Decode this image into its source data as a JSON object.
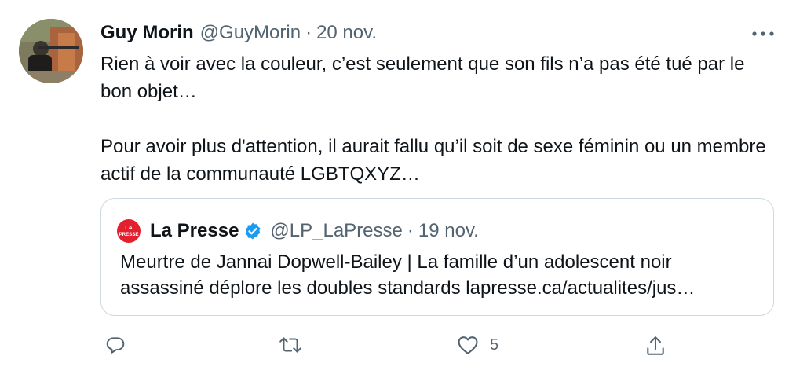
{
  "tweet": {
    "author_name": "Guy Morin",
    "author_handle": "@GuyMorin",
    "separator": "·",
    "date": "20 nov.",
    "more_icon": "more-dots-icon",
    "text_lines": [
      "Rien à voir avec la couleur, c’est seulement que son fils n’a pas été tué par le bon objet…",
      "Pour avoir plus d'attention, il aurait fallu qu’il soit de sexe féminin ou un membre actif de la communauté LGBTQXYZ…"
    ]
  },
  "quote": {
    "logo_text_top": "LA",
    "logo_text_bottom": "PRESSE",
    "author_name": "La Presse",
    "verified_icon": "verified-badge-icon",
    "author_handle": "@LP_LaPresse",
    "separator": "·",
    "date": "19 nov.",
    "text_line1": "Meurtre de Jannai Dopwell-Bailey | La famille d’un adolescent noir",
    "text_line2": "assassiné déplore les doubles standards lapresse.ca/actualites/jus…"
  },
  "actions": {
    "reply_icon": "reply-icon",
    "retweet_icon": "retweet-icon",
    "like_icon": "like-heart-icon",
    "like_count": "5",
    "share_icon": "share-icon"
  },
  "colors": {
    "text": "#0f1419",
    "secondary": "#536471",
    "border": "#cfd9de",
    "verified": "#1d9bf0",
    "lapresse_red": "#e2202e"
  }
}
